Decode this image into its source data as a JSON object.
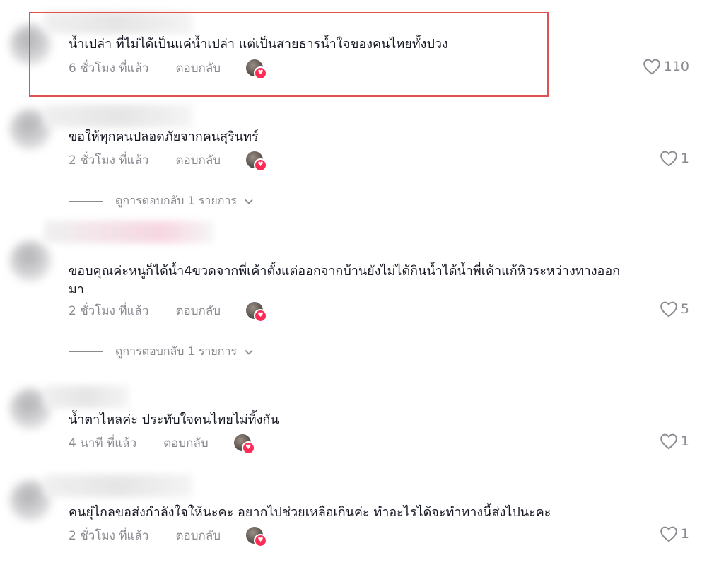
{
  "colors": {
    "highlight": "#e05252",
    "text": "#161823",
    "muted": "#8a8b91",
    "heart_badge": "#fe2c55"
  },
  "comments": [
    {
      "text": "น้ำเปล่า ที่ไม่ได้เป็นแค่น้ำเปล่า แต่เป็นสายธารน้ำใจของคนไทยทั้งปวง",
      "time": "6 ชั่วโมง ที่แล้ว",
      "reply": "ตอบกลับ",
      "likes": "110"
    },
    {
      "text": "ขอให้ทุกคนปลอดภัยจากคนสุรินทร์",
      "time": "2 ชั่วโมง ที่แล้ว",
      "reply": "ตอบกลับ",
      "likes": "1",
      "view_replies": "ดูการตอบกลับ 1 รายการ"
    },
    {
      "text": "ขอบคุณค่ะหนูก็ได้น้ำ4ขวดจากพี่เค้าตั้งแต่ออกจากบ้านยังไม่ได้กินน้ำได้น้ำพี่เค้าแก้หิวระหว่างทางออก",
      "text_line2": "มา",
      "time": "2 ชั่วโมง ที่แล้ว",
      "reply": "ตอบกลับ",
      "likes": "5",
      "view_replies": "ดูการตอบกลับ 1 รายการ"
    },
    {
      "text": "น้ำตาไหลค่ะ ประทับใจคนไทยไม่ทิ้งกัน",
      "time": "4 นาที ที่แล้ว",
      "reply": "ตอบกลับ",
      "likes": "1"
    },
    {
      "text": "คนยุ่ไกลขอส่งกำลังใจให้นะคะ อยากไปช่วยเหลือเกินค่ะ ทำอะไรได้จะทำทางนี้ส่งไปนะคะ",
      "time": "2 ชั่วโมง ที่แล้ว",
      "reply": "ตอบกลับ",
      "likes": "1"
    }
  ],
  "icons": {
    "like": "heart-outline-icon",
    "expand": "chevron-down-icon",
    "creator_liked": "heart-badge-icon"
  }
}
